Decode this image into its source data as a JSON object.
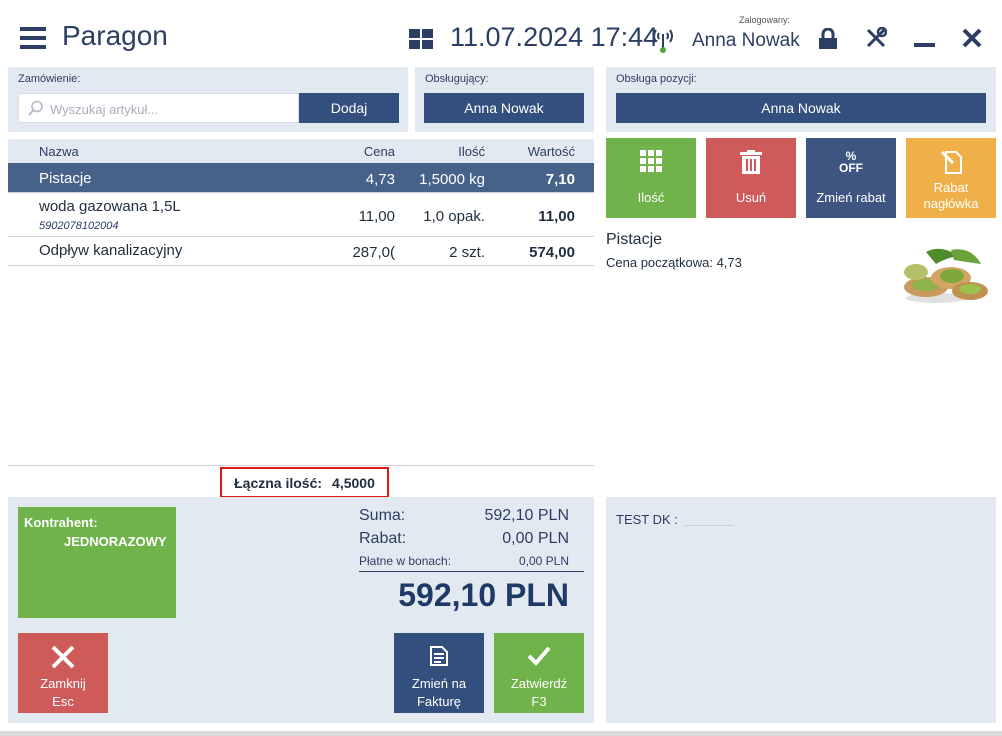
{
  "app": {
    "title": "Paragon",
    "datetime": "11.07.2024 17:44",
    "logged_label": "Zalogowany:",
    "user": "Anna Nowak"
  },
  "order": {
    "label": "Zamówienie:",
    "search_placeholder": "Wyszukaj artykuł...",
    "add_label": "Dodaj"
  },
  "served": {
    "label": "Obsługujący:",
    "value": "Anna Nowak"
  },
  "item_service": {
    "label": "Obsługa pozycji:",
    "value": "Anna Nowak"
  },
  "table": {
    "headers": [
      "Nazwa",
      "Cena",
      "Ilość",
      "Wartość"
    ],
    "rows": [
      {
        "name": "Pistacje",
        "price": "4,73",
        "qty": "1,5000 kg",
        "value": "7,10",
        "ean": ""
      },
      {
        "name": "woda gazowana 1,5L",
        "price": "11,00",
        "qty": "1,0 opak.",
        "value": "11,00",
        "ean": "5902078102004"
      },
      {
        "name": "Odpływ kanalizacyjny",
        "price": "287,0(",
        "qty": "2 szt.",
        "value": "574,00",
        "ean": ""
      }
    ],
    "total_qty_label": "Łączna ilość:",
    "total_qty_value": "4,5000"
  },
  "actions": [
    {
      "label": "Ilość",
      "icon": "grid-icon",
      "color": "#6fb34a"
    },
    {
      "label": "Usuń",
      "icon": "trash-icon",
      "color": "#cf5a5a"
    },
    {
      "label": "Zmień rabat",
      "icon": "percent-off-icon",
      "color": "#3d5580"
    },
    {
      "label": "Rabat nagłówka",
      "icon": "edit-document-icon",
      "color": "#efb04a"
    }
  ],
  "detail": {
    "name": "Pistacje",
    "start_price": "Cena początkowa: 4,73"
  },
  "customer": {
    "label": "Kontrahent:",
    "value": "JEDNORAZOWY"
  },
  "summary": {
    "sum_label": "Suma:",
    "sum_value": "592,10 PLN",
    "discount_label": "Rabat:",
    "discount_value": "0,00 PLN",
    "vouchers_label": "Płatne w bonach:",
    "vouchers_value": "0,00 PLN",
    "total": "592,10 PLN"
  },
  "buttons": {
    "close": "Zamknij",
    "close_key": "Esc",
    "invoice_line1": "Zmień na",
    "invoice_line2": "Fakturę",
    "confirm": "Zatwierdź",
    "confirm_key": "F3"
  },
  "attribute": {
    "label": "TEST DK :"
  },
  "colors": {
    "navy": "#324f7d",
    "selected_row": "#476289",
    "panel": "#e3e9f1",
    "green": "#6fb34a",
    "red": "#cf5a5a",
    "highlight": "#e01818"
  }
}
